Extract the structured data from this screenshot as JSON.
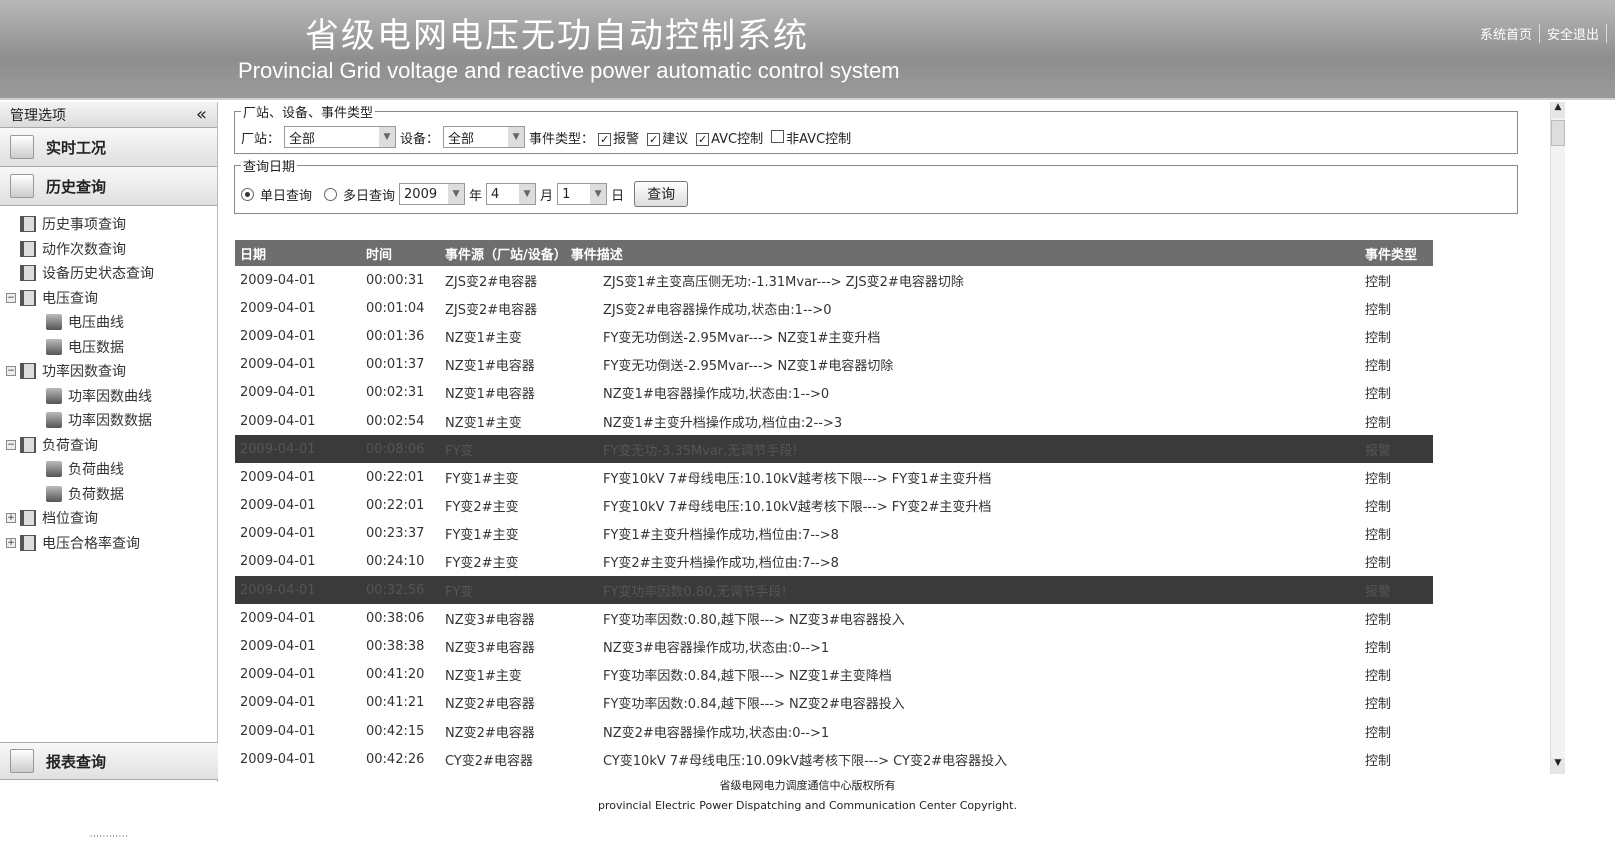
{
  "header": {
    "title_cn": "省级电网电压无功自动控制系统",
    "title_en": "Provincial Grid voltage and reactive power automatic control system",
    "links": [
      "系统首页",
      "安全退出"
    ]
  },
  "sidebar": {
    "title": "管理选项",
    "collapse_icon": "«",
    "sections": [
      "实时工况",
      "历史查询"
    ],
    "tree": [
      {
        "label": "历史事项查询",
        "level": 0,
        "exp": ""
      },
      {
        "label": "动作次数查询",
        "level": 0,
        "exp": ""
      },
      {
        "label": "设备历史状态查询",
        "level": 0,
        "exp": ""
      },
      {
        "label": "电压查询",
        "level": 0,
        "exp": "-"
      },
      {
        "label": "电压曲线",
        "level": 1
      },
      {
        "label": "电压数据",
        "level": 1
      },
      {
        "label": "功率因数查询",
        "level": 0,
        "exp": "-"
      },
      {
        "label": "功率因数曲线",
        "level": 1
      },
      {
        "label": "功率因数数据",
        "level": 1
      },
      {
        "label": "负荷查询",
        "level": 0,
        "exp": "-"
      },
      {
        "label": "负荷曲线",
        "level": 1
      },
      {
        "label": "负荷数据",
        "level": 1
      },
      {
        "label": "档位查询",
        "level": 0,
        "exp": "+"
      },
      {
        "label": "电压合格率查询",
        "level": 0,
        "exp": "+"
      }
    ],
    "bottom": "报表查询"
  },
  "filter": {
    "legend": "厂站、设备、事件类型",
    "station_label": "厂站：",
    "station_value": "全部",
    "device_label": "设备：",
    "device_value": "全部",
    "type_label": "事件类型：",
    "types": [
      {
        "label": "报警",
        "checked": true
      },
      {
        "label": "建议",
        "checked": true
      },
      {
        "label": "AVC控制",
        "checked": true
      },
      {
        "label": "非AVC控制",
        "checked": false
      }
    ]
  },
  "date": {
    "legend": "查询日期",
    "single": "单日查询",
    "multi": "多日查询",
    "year": "2009",
    "year_label": "年",
    "month": "4",
    "month_label": "月",
    "day": "1",
    "day_label": "日",
    "query_button": "查询"
  },
  "table": {
    "headers": [
      "日期",
      "时间",
      "事件源（厂站/设备）",
      "事件描述",
      "事件类型"
    ],
    "rows": [
      [
        "2009-04-01",
        "00:00:31",
        "ZJS变2#电容器",
        "ZJS变1#主变高压侧无功:-1.31Mvar--->  ZJS变2#电容器切除",
        "控制",
        false
      ],
      [
        "2009-04-01",
        "00:01:04",
        "ZJS变2#电容器",
        "ZJS变2#电容器操作成功,状态由:1-->0",
        "控制",
        false
      ],
      [
        "2009-04-01",
        "00:01:36",
        "NZ变1#主变",
        "FY变无功倒送-2.95Mvar--->  NZ变1#主变升档",
        "控制",
        false
      ],
      [
        "2009-04-01",
        "00:01:37",
        "NZ变1#电容器",
        "FY变无功倒送-2.95Mvar--->  NZ变1#电容器切除",
        "控制",
        false
      ],
      [
        "2009-04-01",
        "00:02:31",
        "NZ变1#电容器",
        "NZ变1#电容器操作成功,状态由:1-->0",
        "控制",
        false
      ],
      [
        "2009-04-01",
        "00:02:54",
        "NZ变1#主变",
        "NZ变1#主变升档操作成功,档位由:2-->3",
        "控制",
        false
      ],
      [
        "2009-04-01",
        "00:08:06",
        "FY变",
        "FY变无功-3.35Mvar,无调节手段!",
        "报警",
        true
      ],
      [
        "2009-04-01",
        "00:22:01",
        "FY变1#主变",
        "FY变10kV 7#母线电压:10.10kV越考核下限--->  FY变1#主变升档",
        "控制",
        false
      ],
      [
        "2009-04-01",
        "00:22:01",
        "FY变2#主变",
        "FY变10kV 7#母线电压:10.10kV越考核下限--->  FY变2#主变升档",
        "控制",
        false
      ],
      [
        "2009-04-01",
        "00:23:37",
        "FY变1#主变",
        "FY变1#主变升档操作成功,档位由:7-->8",
        "控制",
        false
      ],
      [
        "2009-04-01",
        "00:24:10",
        "FY变2#主变",
        "FY变2#主变升档操作成功,档位由:7-->8",
        "控制",
        false
      ],
      [
        "2009-04-01",
        "00:32:56",
        "FY变",
        "FY变功率因数0.80,无调节手段!",
        "报警",
        true
      ],
      [
        "2009-04-01",
        "00:38:06",
        "NZ变3#电容器",
        "FY变功率因数:0.80,越下限--->  NZ变3#电容器投入",
        "控制",
        false
      ],
      [
        "2009-04-01",
        "00:38:38",
        "NZ变3#电容器",
        "NZ变3#电容器操作成功,状态由:0-->1",
        "控制",
        false
      ],
      [
        "2009-04-01",
        "00:41:20",
        "NZ变1#主变",
        "FY变功率因数:0.84,越下限--->  NZ变1#主变降档",
        "控制",
        false
      ],
      [
        "2009-04-01",
        "00:41:21",
        "NZ变2#电容器",
        "FY变功率因数:0.84,越下限--->  NZ变2#电容器投入",
        "控制",
        false
      ],
      [
        "2009-04-01",
        "00:42:15",
        "NZ变2#电容器",
        "NZ变2#电容器操作成功,状态由:0-->1",
        "控制",
        false
      ],
      [
        "2009-04-01",
        "00:42:26",
        "CY变2#电容器",
        "CY变10kV 7#母线电压:10.09kV越考核下限--->  CY变2#电容器投入",
        "控制",
        false
      ]
    ]
  },
  "footer": {
    "line1": "省级电网电力调度通信中心版权所有",
    "line2": "provincial Electric Power Dispatching and Communication Center Copyright."
  }
}
